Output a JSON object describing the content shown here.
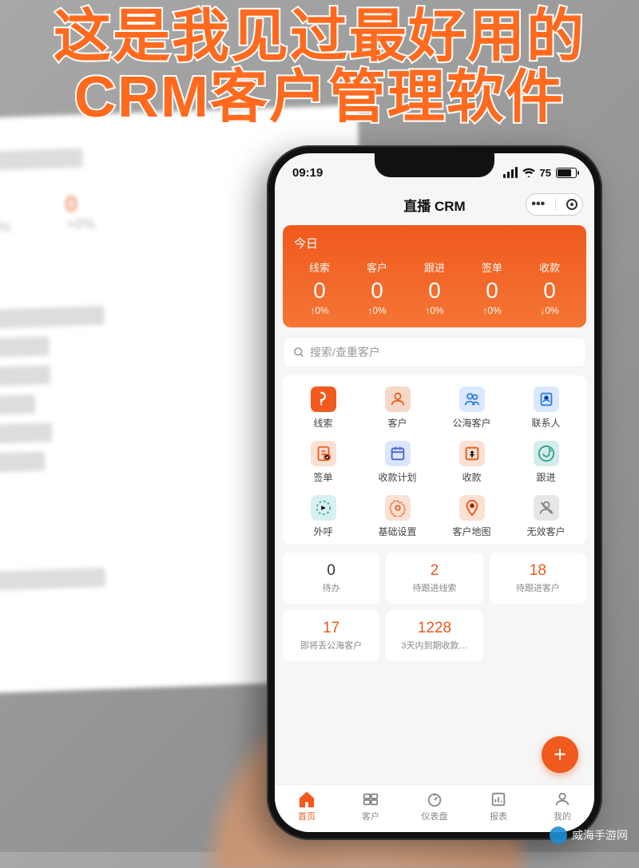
{
  "overlay": {
    "headline_line1": "这是我见过最好用的",
    "headline_line2": "CRM客户管理软件",
    "watermark": "威海手游网"
  },
  "statusbar": {
    "time": "09:19",
    "battery": "75"
  },
  "titlebar": {
    "title": "直播 CRM"
  },
  "summary": {
    "period": "今日",
    "metrics": [
      {
        "label": "线索",
        "value": "0",
        "delta": "↑0%"
      },
      {
        "label": "客户",
        "value": "0",
        "delta": "↑0%"
      },
      {
        "label": "跟进",
        "value": "0",
        "delta": "↑0%"
      },
      {
        "label": "签单",
        "value": "0",
        "delta": "↑0%"
      },
      {
        "label": "收款",
        "value": "0",
        "delta": "↓0%"
      }
    ]
  },
  "search": {
    "placeholder": "搜索/查重客户"
  },
  "grid": [
    {
      "name": "leads",
      "label": "线索",
      "color": "#f05a1e",
      "iconColor": "#fff"
    },
    {
      "name": "customers",
      "label": "客户",
      "color": "#f5d8c8",
      "iconColor": "#f05a1e"
    },
    {
      "name": "public-pool",
      "label": "公海客户",
      "color": "#dbe9ff",
      "iconColor": "#2f7de0"
    },
    {
      "name": "contacts",
      "label": "联系人",
      "color": "#dbe9ff",
      "iconColor": "#2f7de0"
    },
    {
      "name": "contracts",
      "label": "签单",
      "color": "#fbe0d4",
      "iconColor": "#f05a1e"
    },
    {
      "name": "payment-plan",
      "label": "收款计划",
      "color": "#dce6ff",
      "iconColor": "#4a62d8"
    },
    {
      "name": "payments",
      "label": "收款",
      "color": "#fbe0d4",
      "iconColor": "#e8591c"
    },
    {
      "name": "followups",
      "label": "跟进",
      "color": "#d6ecea",
      "iconColor": "#2fa18f"
    },
    {
      "name": "outbound",
      "label": "外呼",
      "color": "#d8f1f0",
      "iconColor": "#35b1ab"
    },
    {
      "name": "settings",
      "label": "基础设置",
      "color": "#fbe0d4",
      "iconColor": "#e8591c"
    },
    {
      "name": "cust-map",
      "label": "客户地图",
      "color": "#fbe0d4",
      "iconColor": "#e8591c"
    },
    {
      "name": "invalid",
      "label": "无效客户",
      "color": "#e6e6e6",
      "iconColor": "#888"
    }
  ],
  "cards": [
    {
      "value": "0",
      "label": "待办",
      "hot": false
    },
    {
      "value": "2",
      "label": "待跟进线索",
      "hot": true
    },
    {
      "value": "18",
      "label": "待跟进客户",
      "hot": true
    },
    {
      "value": "17",
      "label": "即将丢公海客户",
      "hot": true
    },
    {
      "value": "1228",
      "label": "3天内到期收款…",
      "hot": true
    }
  ],
  "tabbar": [
    {
      "name": "home",
      "label": "首页",
      "active": true
    },
    {
      "name": "customers",
      "label": "客户",
      "active": false
    },
    {
      "name": "dashboard",
      "label": "仪表盘",
      "active": false
    },
    {
      "name": "reports",
      "label": "报表",
      "active": false
    },
    {
      "name": "me",
      "label": "我的",
      "active": false
    }
  ]
}
